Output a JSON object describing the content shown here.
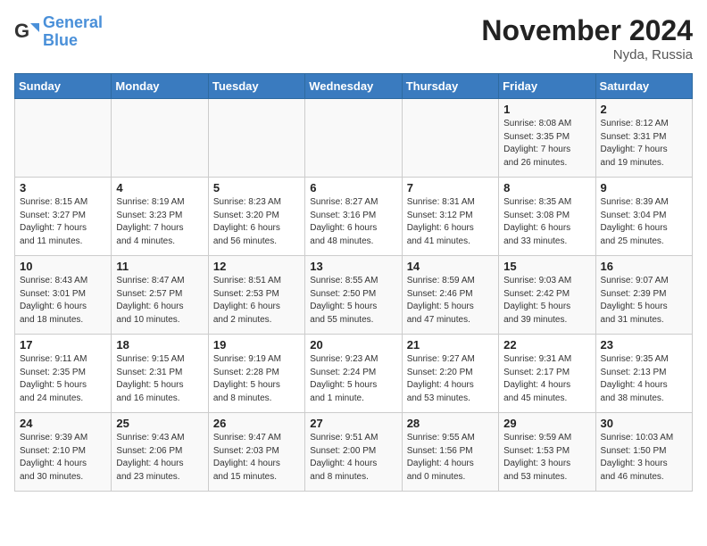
{
  "logo": {
    "line1": "General",
    "line2": "Blue"
  },
  "title": "November 2024",
  "location": "Nyda, Russia",
  "days_of_week": [
    "Sunday",
    "Monday",
    "Tuesday",
    "Wednesday",
    "Thursday",
    "Friday",
    "Saturday"
  ],
  "weeks": [
    [
      {
        "day": "",
        "info": ""
      },
      {
        "day": "",
        "info": ""
      },
      {
        "day": "",
        "info": ""
      },
      {
        "day": "",
        "info": ""
      },
      {
        "day": "",
        "info": ""
      },
      {
        "day": "1",
        "info": "Sunrise: 8:08 AM\nSunset: 3:35 PM\nDaylight: 7 hours\nand 26 minutes."
      },
      {
        "day": "2",
        "info": "Sunrise: 8:12 AM\nSunset: 3:31 PM\nDaylight: 7 hours\nand 19 minutes."
      }
    ],
    [
      {
        "day": "3",
        "info": "Sunrise: 8:15 AM\nSunset: 3:27 PM\nDaylight: 7 hours\nand 11 minutes."
      },
      {
        "day": "4",
        "info": "Sunrise: 8:19 AM\nSunset: 3:23 PM\nDaylight: 7 hours\nand 4 minutes."
      },
      {
        "day": "5",
        "info": "Sunrise: 8:23 AM\nSunset: 3:20 PM\nDaylight: 6 hours\nand 56 minutes."
      },
      {
        "day": "6",
        "info": "Sunrise: 8:27 AM\nSunset: 3:16 PM\nDaylight: 6 hours\nand 48 minutes."
      },
      {
        "day": "7",
        "info": "Sunrise: 8:31 AM\nSunset: 3:12 PM\nDaylight: 6 hours\nand 41 minutes."
      },
      {
        "day": "8",
        "info": "Sunrise: 8:35 AM\nSunset: 3:08 PM\nDaylight: 6 hours\nand 33 minutes."
      },
      {
        "day": "9",
        "info": "Sunrise: 8:39 AM\nSunset: 3:04 PM\nDaylight: 6 hours\nand 25 minutes."
      }
    ],
    [
      {
        "day": "10",
        "info": "Sunrise: 8:43 AM\nSunset: 3:01 PM\nDaylight: 6 hours\nand 18 minutes."
      },
      {
        "day": "11",
        "info": "Sunrise: 8:47 AM\nSunset: 2:57 PM\nDaylight: 6 hours\nand 10 minutes."
      },
      {
        "day": "12",
        "info": "Sunrise: 8:51 AM\nSunset: 2:53 PM\nDaylight: 6 hours\nand 2 minutes."
      },
      {
        "day": "13",
        "info": "Sunrise: 8:55 AM\nSunset: 2:50 PM\nDaylight: 5 hours\nand 55 minutes."
      },
      {
        "day": "14",
        "info": "Sunrise: 8:59 AM\nSunset: 2:46 PM\nDaylight: 5 hours\nand 47 minutes."
      },
      {
        "day": "15",
        "info": "Sunrise: 9:03 AM\nSunset: 2:42 PM\nDaylight: 5 hours\nand 39 minutes."
      },
      {
        "day": "16",
        "info": "Sunrise: 9:07 AM\nSunset: 2:39 PM\nDaylight: 5 hours\nand 31 minutes."
      }
    ],
    [
      {
        "day": "17",
        "info": "Sunrise: 9:11 AM\nSunset: 2:35 PM\nDaylight: 5 hours\nand 24 minutes."
      },
      {
        "day": "18",
        "info": "Sunrise: 9:15 AM\nSunset: 2:31 PM\nDaylight: 5 hours\nand 16 minutes."
      },
      {
        "day": "19",
        "info": "Sunrise: 9:19 AM\nSunset: 2:28 PM\nDaylight: 5 hours\nand 8 minutes."
      },
      {
        "day": "20",
        "info": "Sunrise: 9:23 AM\nSunset: 2:24 PM\nDaylight: 5 hours\nand 1 minute."
      },
      {
        "day": "21",
        "info": "Sunrise: 9:27 AM\nSunset: 2:20 PM\nDaylight: 4 hours\nand 53 minutes."
      },
      {
        "day": "22",
        "info": "Sunrise: 9:31 AM\nSunset: 2:17 PM\nDaylight: 4 hours\nand 45 minutes."
      },
      {
        "day": "23",
        "info": "Sunrise: 9:35 AM\nSunset: 2:13 PM\nDaylight: 4 hours\nand 38 minutes."
      }
    ],
    [
      {
        "day": "24",
        "info": "Sunrise: 9:39 AM\nSunset: 2:10 PM\nDaylight: 4 hours\nand 30 minutes."
      },
      {
        "day": "25",
        "info": "Sunrise: 9:43 AM\nSunset: 2:06 PM\nDaylight: 4 hours\nand 23 minutes."
      },
      {
        "day": "26",
        "info": "Sunrise: 9:47 AM\nSunset: 2:03 PM\nDaylight: 4 hours\nand 15 minutes."
      },
      {
        "day": "27",
        "info": "Sunrise: 9:51 AM\nSunset: 2:00 PM\nDaylight: 4 hours\nand 8 minutes."
      },
      {
        "day": "28",
        "info": "Sunrise: 9:55 AM\nSunset: 1:56 PM\nDaylight: 4 hours\nand 0 minutes."
      },
      {
        "day": "29",
        "info": "Sunrise: 9:59 AM\nSunset: 1:53 PM\nDaylight: 3 hours\nand 53 minutes."
      },
      {
        "day": "30",
        "info": "Sunrise: 10:03 AM\nSunset: 1:50 PM\nDaylight: 3 hours\nand 46 minutes."
      }
    ]
  ]
}
